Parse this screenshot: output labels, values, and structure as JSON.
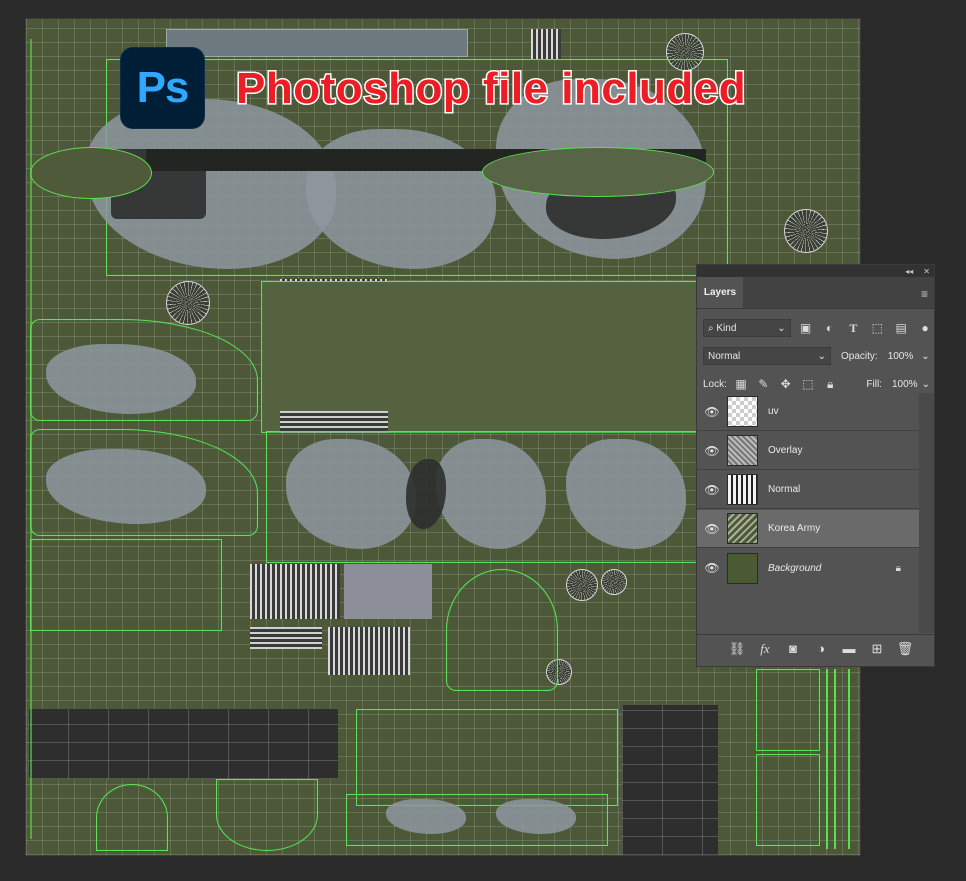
{
  "banner": {
    "logo_text": "Ps",
    "headline": "Photoshop file included"
  },
  "layers_panel": {
    "tab_label": "Layers",
    "filter_kind": "Kind",
    "blend_mode": "Normal",
    "opacity_label": "Opacity:",
    "opacity_value": "100%",
    "lock_label": "Lock:",
    "fill_label": "Fill:",
    "fill_value": "100%",
    "layers": [
      {
        "name": "uv",
        "visible": true,
        "selected": false,
        "thumb": "transparent"
      },
      {
        "name": "Overlay",
        "visible": true,
        "selected": false,
        "thumb": "noise"
      },
      {
        "name": "Normal",
        "visible": true,
        "selected": false,
        "thumb": "normal"
      },
      {
        "name": "Korea Army",
        "visible": true,
        "selected": true,
        "thumb": "army"
      },
      {
        "name": "Background",
        "visible": true,
        "selected": false,
        "thumb": "solid",
        "locked": true
      }
    ],
    "filter_icons": [
      "image-filter-icon",
      "adjustment-filter-icon",
      "type-filter-icon",
      "shape-filter-icon",
      "smart-object-filter-icon",
      "filter-toggle-icon"
    ],
    "lock_icons": [
      "lock-transparent-icon",
      "lock-paint-icon",
      "lock-position-icon",
      "lock-artboard-icon",
      "lock-all-icon"
    ],
    "bottom_icons": [
      "link-layers-icon",
      "fx-icon",
      "add-mask-icon",
      "adjustment-layer-icon",
      "new-group-icon",
      "new-layer-icon",
      "trash-icon"
    ]
  },
  "colors": {
    "texture_base": "#4c5838",
    "uv_wire": "#5be04f",
    "headline_red": "#ee1c24",
    "ps_blue": "#31a8ff",
    "panel_bg": "#535353"
  }
}
